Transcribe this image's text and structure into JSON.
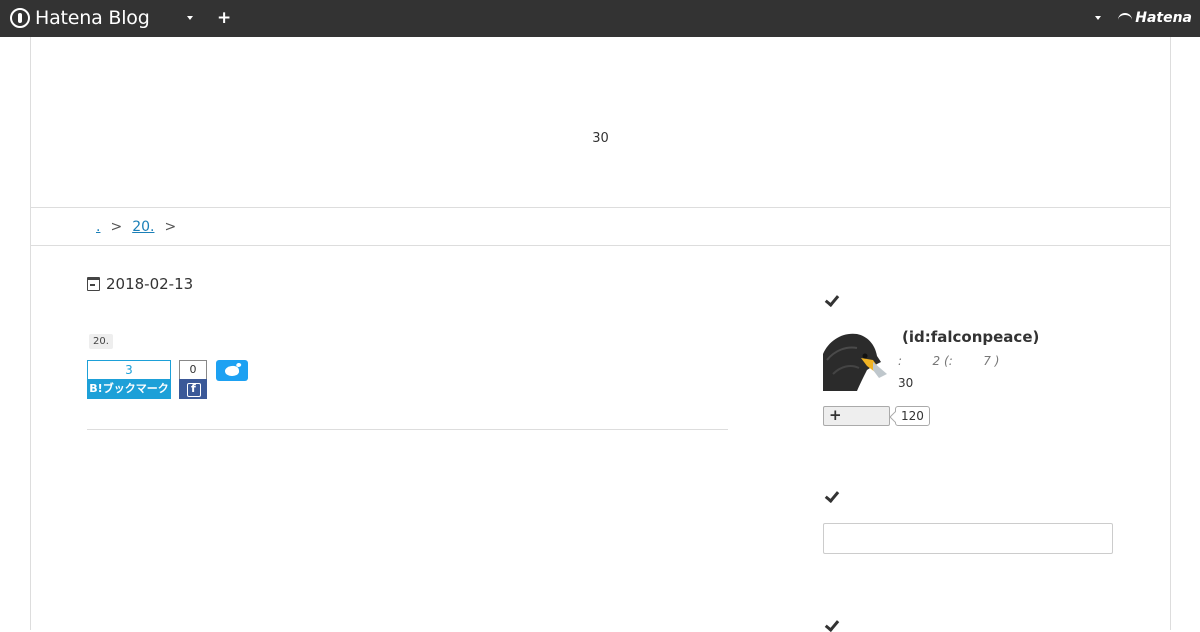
{
  "header": {
    "logo_text": "Hatena Blog",
    "add_symbol": "+",
    "brand_text": "Hatena"
  },
  "blog": {
    "title": "30"
  },
  "breadcrumb": {
    "items": [
      ".",
      "20."
    ],
    "separator": ">"
  },
  "entry": {
    "date": "2018-02-13",
    "category": "20.",
    "hatena_bookmark": {
      "count": "3",
      "label": "B!ブックマーク"
    },
    "facebook": {
      "count": "0"
    },
    "icons": {
      "date": "calendar-icon",
      "facebook": "facebook-icon",
      "twitter": "twitter-icon"
    }
  },
  "sidebar": {
    "profile": {
      "id_text": " (id:falconpeace)",
      "meta_text": ":        2 (:        7 )",
      "count_text": "30",
      "follow_symbol": "+",
      "follow_count": "120"
    },
    "search": {
      "value": ""
    },
    "icons": {
      "section": "check-icon",
      "avatar": "falcon-avatar"
    }
  },
  "colors": {
    "header_bg": "#333333",
    "link": "#1a7fb7",
    "hatena_bookmark": "#1da0d8",
    "facebook": "#3b5998",
    "twitter": "#1da1f2"
  }
}
